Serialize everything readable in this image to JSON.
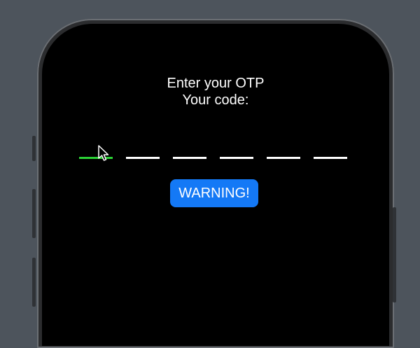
{
  "screen": {
    "title_line1": "Enter your OTP",
    "title_line2": "Your code:"
  },
  "otp": {
    "slots": [
      {
        "value": "",
        "state": "active"
      },
      {
        "value": "",
        "state": "empty"
      },
      {
        "value": "",
        "state": "empty"
      },
      {
        "value": "",
        "state": "empty"
      },
      {
        "value": "",
        "state": "empty"
      },
      {
        "value": "",
        "state": "empty"
      }
    ],
    "active_color": "#2bd135",
    "inactive_color": "#ffffff"
  },
  "warning_button": {
    "label": "WARNING!",
    "color": "#1479f6"
  },
  "cursor": {
    "icon": "mouse-pointer-icon"
  }
}
